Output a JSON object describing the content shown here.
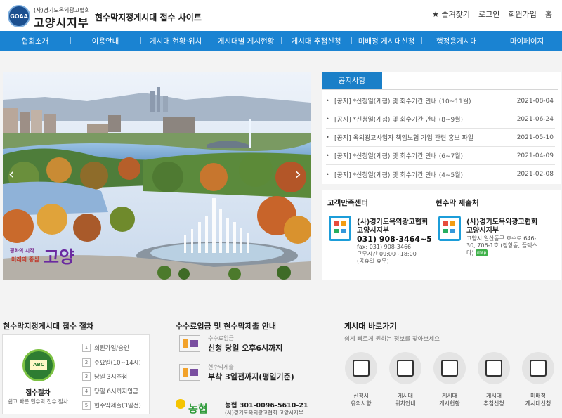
{
  "header": {
    "org_small": "(사)경기도옥외광고협회",
    "org_big": "고양시지부",
    "logo_text": "GOAA",
    "site_title": "현수막지정게시대 접수 사이트",
    "util": [
      "★ 즐겨찾기",
      "로그인",
      "회원가입",
      "홈"
    ]
  },
  "nav": [
    "협회소개",
    "이용안내",
    "게시대 현황·위치",
    "게시대별 게시현황",
    "게시대 추첨신청",
    "미배정 게시대신청",
    "행정용게시대",
    "마이페이지"
  ],
  "banner": {
    "slogan_small": "평화의 시작",
    "slogan_small2": "미래의 중심",
    "slogan_big": "고양",
    "prev": "‹",
    "next": "›"
  },
  "notice": {
    "tab": "공지사항",
    "items": [
      {
        "title": "[공지] *신청일(게첨) 및 회수기간 안내 (10~11월)",
        "date": "2021-08-04"
      },
      {
        "title": "[공지] *신청일(게첨) 및 회수기간 안내 (8~9월)",
        "date": "2021-06-24"
      },
      {
        "title": "[공지] 옥외광고사업자 책임보험 가입 관련 홍보 파일",
        "date": "2021-05-10"
      },
      {
        "title": "[공지] *신청일(게첨) 및 회수기간 안내 (6~7월)",
        "date": "2021-04-09"
      },
      {
        "title": "[공지] *신청일(게첨) 및 회수기간 안내 (4~5월)",
        "date": "2021-02-08"
      }
    ]
  },
  "service": {
    "heading": "고객만족센터",
    "name": "(사)경기도옥외광고협회 고양시지부",
    "phone": "031) 908-3464~5",
    "fax": "fax: 031) 908-3466",
    "hours": "근무시간 09:00~18:00",
    "holiday": "(공휴일 휴무)"
  },
  "submit": {
    "heading": "현수막 제출처",
    "name": "(사)경기도옥외광고협회 고양시지부",
    "address": "고양시 일산동구 호수로 646-30, 706-1호 (장항동, 플렉스타)",
    "map": "map"
  },
  "steps": {
    "heading": "현수막지정게시대 접수 절차",
    "board": "ABC",
    "title": "접수절차",
    "desc": "쉽고 빠른 현수막 접수 절차",
    "items": [
      {
        "n": "1",
        "t": "회원가입/승인"
      },
      {
        "n": "2",
        "t": "수요일(10~14시)"
      },
      {
        "n": "3",
        "t": "당일 3시추첨"
      },
      {
        "n": "4",
        "t": "당일 6시까지입금"
      },
      {
        "n": "5",
        "t": "현수막제출(3일전)"
      }
    ]
  },
  "payment": {
    "heading": "수수료입금 및 현수막제출 안내",
    "sub1": "수수료입금",
    "main1": "신청 당일 오후6시까지",
    "sub2": "현수막제출",
    "main2": "부착 3일전까지(평일기준)",
    "bank_logo": "농협",
    "account": "농협 301-0096-5610-21",
    "holder": "(사)경기도옥외광고협회 고양시지부"
  },
  "quick": {
    "heading": "게시대 바로가기",
    "desc": "쉽게 빠르게 원하는 정보를 찾아보세요",
    "items": [
      {
        "l1": "신청시",
        "l2": "유의사항"
      },
      {
        "l1": "게시대",
        "l2": "위치안내"
      },
      {
        "l1": "게시대",
        "l2": "게시현황"
      },
      {
        "l1": "게시대",
        "l2": "추첨신청"
      },
      {
        "l1": "미배정",
        "l2": "게시대신청"
      }
    ]
  }
}
